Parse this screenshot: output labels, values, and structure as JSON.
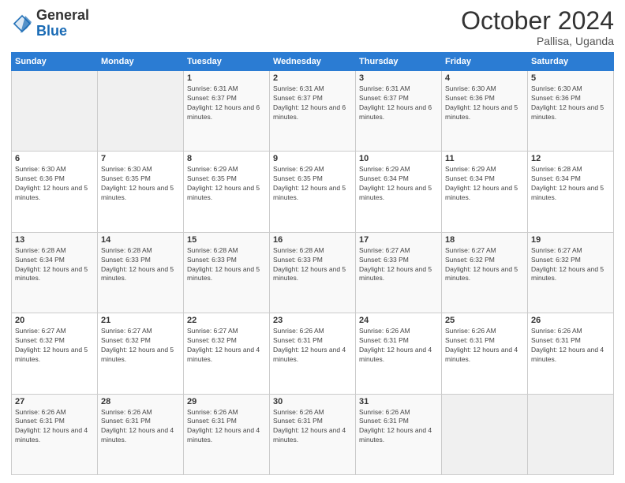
{
  "logo": {
    "general": "General",
    "blue": "Blue"
  },
  "header": {
    "month": "October 2024",
    "location": "Pallisa, Uganda"
  },
  "weekdays": [
    "Sunday",
    "Monday",
    "Tuesday",
    "Wednesday",
    "Thursday",
    "Friday",
    "Saturday"
  ],
  "weeks": [
    [
      {
        "day": "",
        "empty": true
      },
      {
        "day": "",
        "empty": true
      },
      {
        "day": "1",
        "sunrise": "6:31 AM",
        "sunset": "6:37 PM",
        "daylight": "12 hours and 6 minutes."
      },
      {
        "day": "2",
        "sunrise": "6:31 AM",
        "sunset": "6:37 PM",
        "daylight": "12 hours and 6 minutes."
      },
      {
        "day": "3",
        "sunrise": "6:31 AM",
        "sunset": "6:37 PM",
        "daylight": "12 hours and 6 minutes."
      },
      {
        "day": "4",
        "sunrise": "6:30 AM",
        "sunset": "6:36 PM",
        "daylight": "12 hours and 5 minutes."
      },
      {
        "day": "5",
        "sunrise": "6:30 AM",
        "sunset": "6:36 PM",
        "daylight": "12 hours and 5 minutes."
      }
    ],
    [
      {
        "day": "6",
        "sunrise": "6:30 AM",
        "sunset": "6:36 PM",
        "daylight": "12 hours and 5 minutes."
      },
      {
        "day": "7",
        "sunrise": "6:30 AM",
        "sunset": "6:35 PM",
        "daylight": "12 hours and 5 minutes."
      },
      {
        "day": "8",
        "sunrise": "6:29 AM",
        "sunset": "6:35 PM",
        "daylight": "12 hours and 5 minutes."
      },
      {
        "day": "9",
        "sunrise": "6:29 AM",
        "sunset": "6:35 PM",
        "daylight": "12 hours and 5 minutes."
      },
      {
        "day": "10",
        "sunrise": "6:29 AM",
        "sunset": "6:34 PM",
        "daylight": "12 hours and 5 minutes."
      },
      {
        "day": "11",
        "sunrise": "6:29 AM",
        "sunset": "6:34 PM",
        "daylight": "12 hours and 5 minutes."
      },
      {
        "day": "12",
        "sunrise": "6:28 AM",
        "sunset": "6:34 PM",
        "daylight": "12 hours and 5 minutes."
      }
    ],
    [
      {
        "day": "13",
        "sunrise": "6:28 AM",
        "sunset": "6:34 PM",
        "daylight": "12 hours and 5 minutes."
      },
      {
        "day": "14",
        "sunrise": "6:28 AM",
        "sunset": "6:33 PM",
        "daylight": "12 hours and 5 minutes."
      },
      {
        "day": "15",
        "sunrise": "6:28 AM",
        "sunset": "6:33 PM",
        "daylight": "12 hours and 5 minutes."
      },
      {
        "day": "16",
        "sunrise": "6:28 AM",
        "sunset": "6:33 PM",
        "daylight": "12 hours and 5 minutes."
      },
      {
        "day": "17",
        "sunrise": "6:27 AM",
        "sunset": "6:33 PM",
        "daylight": "12 hours and 5 minutes."
      },
      {
        "day": "18",
        "sunrise": "6:27 AM",
        "sunset": "6:32 PM",
        "daylight": "12 hours and 5 minutes."
      },
      {
        "day": "19",
        "sunrise": "6:27 AM",
        "sunset": "6:32 PM",
        "daylight": "12 hours and 5 minutes."
      }
    ],
    [
      {
        "day": "20",
        "sunrise": "6:27 AM",
        "sunset": "6:32 PM",
        "daylight": "12 hours and 5 minutes."
      },
      {
        "day": "21",
        "sunrise": "6:27 AM",
        "sunset": "6:32 PM",
        "daylight": "12 hours and 5 minutes."
      },
      {
        "day": "22",
        "sunrise": "6:27 AM",
        "sunset": "6:32 PM",
        "daylight": "12 hours and 4 minutes."
      },
      {
        "day": "23",
        "sunrise": "6:26 AM",
        "sunset": "6:31 PM",
        "daylight": "12 hours and 4 minutes."
      },
      {
        "day": "24",
        "sunrise": "6:26 AM",
        "sunset": "6:31 PM",
        "daylight": "12 hours and 4 minutes."
      },
      {
        "day": "25",
        "sunrise": "6:26 AM",
        "sunset": "6:31 PM",
        "daylight": "12 hours and 4 minutes."
      },
      {
        "day": "26",
        "sunrise": "6:26 AM",
        "sunset": "6:31 PM",
        "daylight": "12 hours and 4 minutes."
      }
    ],
    [
      {
        "day": "27",
        "sunrise": "6:26 AM",
        "sunset": "6:31 PM",
        "daylight": "12 hours and 4 minutes."
      },
      {
        "day": "28",
        "sunrise": "6:26 AM",
        "sunset": "6:31 PM",
        "daylight": "12 hours and 4 minutes."
      },
      {
        "day": "29",
        "sunrise": "6:26 AM",
        "sunset": "6:31 PM",
        "daylight": "12 hours and 4 minutes."
      },
      {
        "day": "30",
        "sunrise": "6:26 AM",
        "sunset": "6:31 PM",
        "daylight": "12 hours and 4 minutes."
      },
      {
        "day": "31",
        "sunrise": "6:26 AM",
        "sunset": "6:31 PM",
        "daylight": "12 hours and 4 minutes."
      },
      {
        "day": "",
        "empty": true
      },
      {
        "day": "",
        "empty": true
      }
    ]
  ],
  "labels": {
    "sunrise": "Sunrise:",
    "sunset": "Sunset:",
    "daylight": "Daylight:"
  }
}
